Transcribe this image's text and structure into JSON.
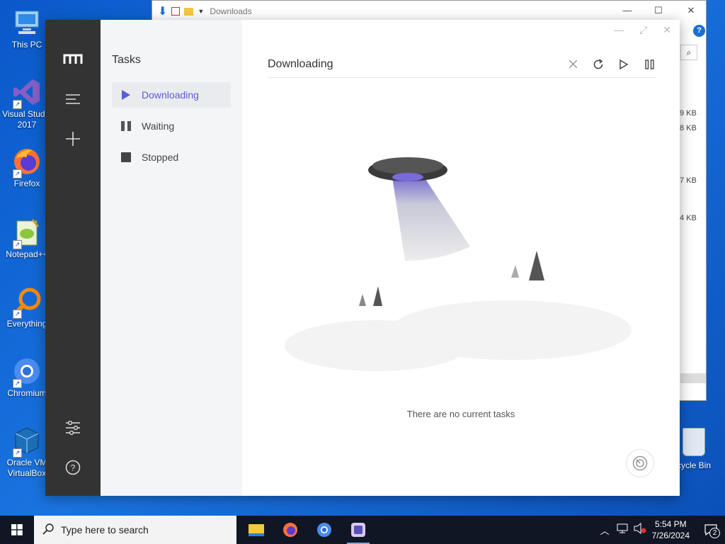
{
  "desktop": {
    "icons": [
      {
        "label": "This PC"
      },
      {
        "label": "Visual Studio 2017"
      },
      {
        "label": "Firefox"
      },
      {
        "label": "Notepad++"
      },
      {
        "label": "Everything"
      },
      {
        "label": "Chromium"
      },
      {
        "label": "Oracle VM VirtualBox"
      }
    ],
    "recycle_bin": "cycle Bin"
  },
  "explorer": {
    "title": "Downloads",
    "sizes": [
      "9 KB",
      "8 KB",
      "7 KB",
      "4 KB"
    ],
    "help": "?"
  },
  "app": {
    "sidebar": {
      "title": "Tasks",
      "items": [
        {
          "label": "Downloading",
          "icon": "play-icon",
          "active": true
        },
        {
          "label": "Waiting",
          "icon": "pause-icon"
        },
        {
          "label": "Stopped",
          "icon": "stop-icon"
        }
      ]
    },
    "header": {
      "title": "Downloading"
    },
    "empty_text": "There are no current tasks",
    "accent_color": "#5b5bd6"
  },
  "taskbar": {
    "search_placeholder": "Type here to search",
    "time": "5:54 PM",
    "date": "7/26/2024",
    "notification_count": "2"
  }
}
